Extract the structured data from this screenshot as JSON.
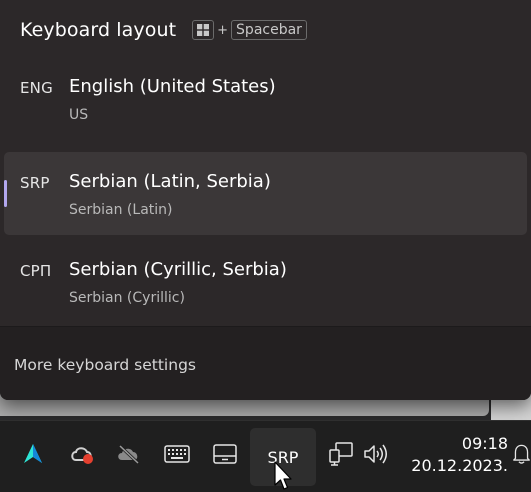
{
  "flyout": {
    "title": "Keyboard layout",
    "shortcut": {
      "plus": "+",
      "key": "Spacebar",
      "win_icon": "windows-logo-icon"
    },
    "languages": [
      {
        "code": "ENG",
        "name": "English (United States)",
        "layout": "US",
        "selected": false
      },
      {
        "code": "SRP",
        "name": "Serbian (Latin, Serbia)",
        "layout": "Serbian (Latin)",
        "selected": true
      },
      {
        "code": "СРП",
        "name": "Serbian (Cyrillic, Serbia)",
        "layout": "Serbian (Cyrillic)",
        "selected": false
      }
    ],
    "footer_link": "More keyboard settings"
  },
  "taskbar": {
    "icons": [
      "app-logo-icon",
      "creative-cloud-icon",
      "onedrive-icon",
      "touch-keyboard-icon",
      "tablet-mode-icon",
      "network-icon",
      "volume-icon",
      "notification-bell-icon"
    ],
    "language_indicator": "SRP",
    "time": "09:18",
    "date": "20.12.2023."
  },
  "colors": {
    "flyout_bg": "#2c2829",
    "selected_bg": "#3b3738",
    "accent": "#b2a7ee",
    "taskbar_bg": "#1f1f1f"
  }
}
